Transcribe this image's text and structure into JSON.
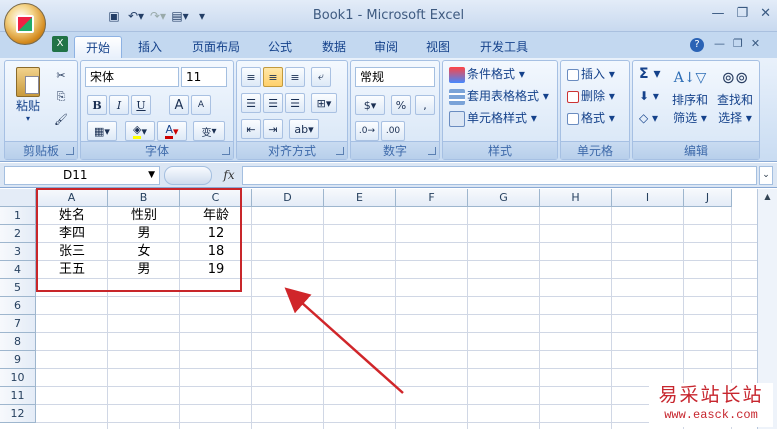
{
  "window": {
    "title": "Book1 - Microsoft Excel"
  },
  "qat": {
    "icons": [
      "save-icon",
      "undo-icon",
      "redo-icon",
      "view-icon",
      "customize-icon"
    ]
  },
  "tabs": [
    {
      "label": "开始",
      "active": true
    },
    {
      "label": "插入"
    },
    {
      "label": "页面布局"
    },
    {
      "label": "公式"
    },
    {
      "label": "数据"
    },
    {
      "label": "审阅"
    },
    {
      "label": "视图"
    },
    {
      "label": "开发工具"
    }
  ],
  "ribbon": {
    "clipboard": {
      "label": "剪贴板",
      "paste": "粘贴"
    },
    "font": {
      "label": "字体",
      "name": "宋体",
      "size": "11",
      "bold": "B",
      "italic": "I",
      "underline": "U",
      "grow": "A",
      "shrink": "A",
      "wen": "变"
    },
    "align": {
      "label": "对齐方式"
    },
    "number": {
      "label": "数字",
      "format": "常规",
      "percent": "%",
      "comma": ","
    },
    "styles": {
      "label": "样式",
      "cond": "条件格式",
      "table": "套用表格格式",
      "cell": "单元格样式"
    },
    "cells": {
      "label": "单元格",
      "insert": "插入",
      "delete": "删除",
      "format": "格式"
    },
    "edit": {
      "label": "编辑",
      "sigma": "Σ",
      "sort1": "排序和",
      "sort2": "筛选",
      "find1": "查找和",
      "find2": "选择"
    }
  },
  "formula": {
    "namebox": "D11",
    "fx": "fx",
    "value": ""
  },
  "columns": [
    "A",
    "B",
    "C",
    "D",
    "E",
    "F",
    "G",
    "H",
    "I",
    "J"
  ],
  "rows": [
    "1",
    "2",
    "3",
    "4",
    "5",
    "6",
    "7",
    "8",
    "9",
    "10",
    "11",
    "12"
  ],
  "cells": [
    [
      "姓名",
      "性别",
      "年龄"
    ],
    [
      "李四",
      "男",
      "12"
    ],
    [
      "张三",
      "女",
      "18"
    ],
    [
      "王五",
      "男",
      "19"
    ]
  ],
  "watermark": {
    "line1": "易采站长站",
    "line2": "www.easck.com"
  },
  "colors": {
    "highlight": "#c8262a",
    "ribbon": "#c9dcf2"
  }
}
